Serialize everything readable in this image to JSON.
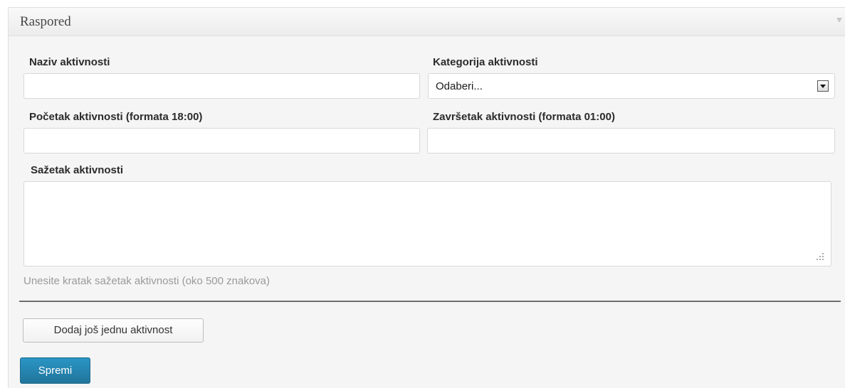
{
  "metabox": {
    "title": "Raspored"
  },
  "form": {
    "name_label": "Naziv aktivnosti",
    "name_value": "",
    "category_label": "Kategorija aktivnosti",
    "category_selected": "Odaberi...",
    "start_label": "Početak aktivnosti (formata 18:00)",
    "start_value": "",
    "end_label": "Završetak aktivnosti (formata 01:00)",
    "end_value": "",
    "summary_label": "Sažetak aktivnosti",
    "summary_hint": "Unesite kratak sažetak aktivnosti (oko 500 znakova)"
  },
  "actions": {
    "add_label": "Dodaj još jednu aktivnost",
    "save_label": "Spremi"
  },
  "colors": {
    "primary_button": "#21759b"
  },
  "icons": {
    "collapse": "triangle-down-icon",
    "select": "dropdown-arrow-icon",
    "resize": "resize-grip-icon"
  }
}
